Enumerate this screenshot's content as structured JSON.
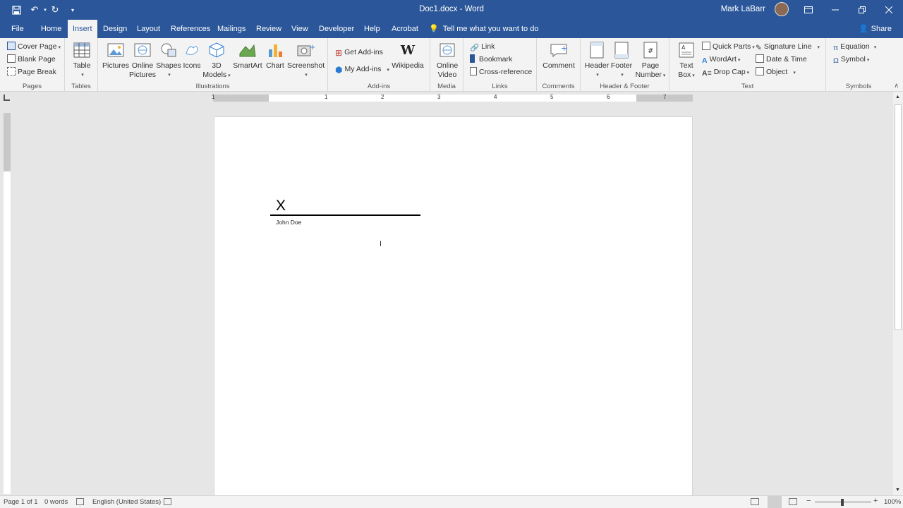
{
  "window": {
    "title": "Doc1.docx  -  Word",
    "user": "Mark LaBarr"
  },
  "tabs": [
    {
      "label": "File"
    },
    {
      "label": "Home"
    },
    {
      "label": "Insert"
    },
    {
      "label": "Design"
    },
    {
      "label": "Layout"
    },
    {
      "label": "References"
    },
    {
      "label": "Mailings"
    },
    {
      "label": "Review"
    },
    {
      "label": "View"
    },
    {
      "label": "Developer"
    },
    {
      "label": "Help"
    },
    {
      "label": "Acrobat"
    }
  ],
  "tell_me": "Tell me what you want to do",
  "share": "Share",
  "ribbon": {
    "pages": {
      "label": "Pages",
      "cover": "Cover Page",
      "blank": "Blank Page",
      "break": "Page Break"
    },
    "tables": {
      "label": "Tables",
      "table": "Table"
    },
    "illustrations": {
      "label": "Illustrations",
      "pictures": "Pictures",
      "online_pictures_1": "Online",
      "online_pictures_2": "Pictures",
      "shapes": "Shapes",
      "icons": "Icons",
      "models_1": "3D",
      "models_2": "Models",
      "smartart": "SmartArt",
      "chart": "Chart",
      "screenshot": "Screenshot"
    },
    "addins": {
      "label": "Add-ins",
      "get": "Get Add-ins",
      "my": "My Add-ins",
      "wikipedia": "Wikipedia"
    },
    "media": {
      "label": "Media",
      "online_video_1": "Online",
      "online_video_2": "Video"
    },
    "links": {
      "label": "Links",
      "link": "Link",
      "bookmark": "Bookmark",
      "crossref": "Cross-reference"
    },
    "comments": {
      "label": "Comments",
      "comment": "Comment"
    },
    "header_footer": {
      "label": "Header & Footer",
      "header": "Header",
      "footer": "Footer",
      "page_number_1": "Page",
      "page_number_2": "Number"
    },
    "text": {
      "label": "Text",
      "textbox_1": "Text",
      "textbox_2": "Box",
      "quick_parts": "Quick Parts",
      "wordart": "WordArt",
      "drop_cap": "Drop Cap",
      "signature_line": "Signature Line",
      "date_time": "Date & Time",
      "object": "Object"
    },
    "symbols": {
      "label": "Symbols",
      "equation": "Equation",
      "symbol": "Symbol"
    }
  },
  "ruler_numbers": [
    "1",
    "1",
    "2",
    "3",
    "4",
    "5",
    "6",
    "7"
  ],
  "document": {
    "signature_x": "X",
    "signer_name": "John Doe"
  },
  "status": {
    "page": "Page 1 of 1",
    "words": "0 words",
    "language": "English (United States)",
    "zoom": "100%"
  },
  "colors": {
    "accent": "#2b579a",
    "ribbon_bg": "#f3f3f3",
    "canvas_bg": "#e6e6e6"
  }
}
